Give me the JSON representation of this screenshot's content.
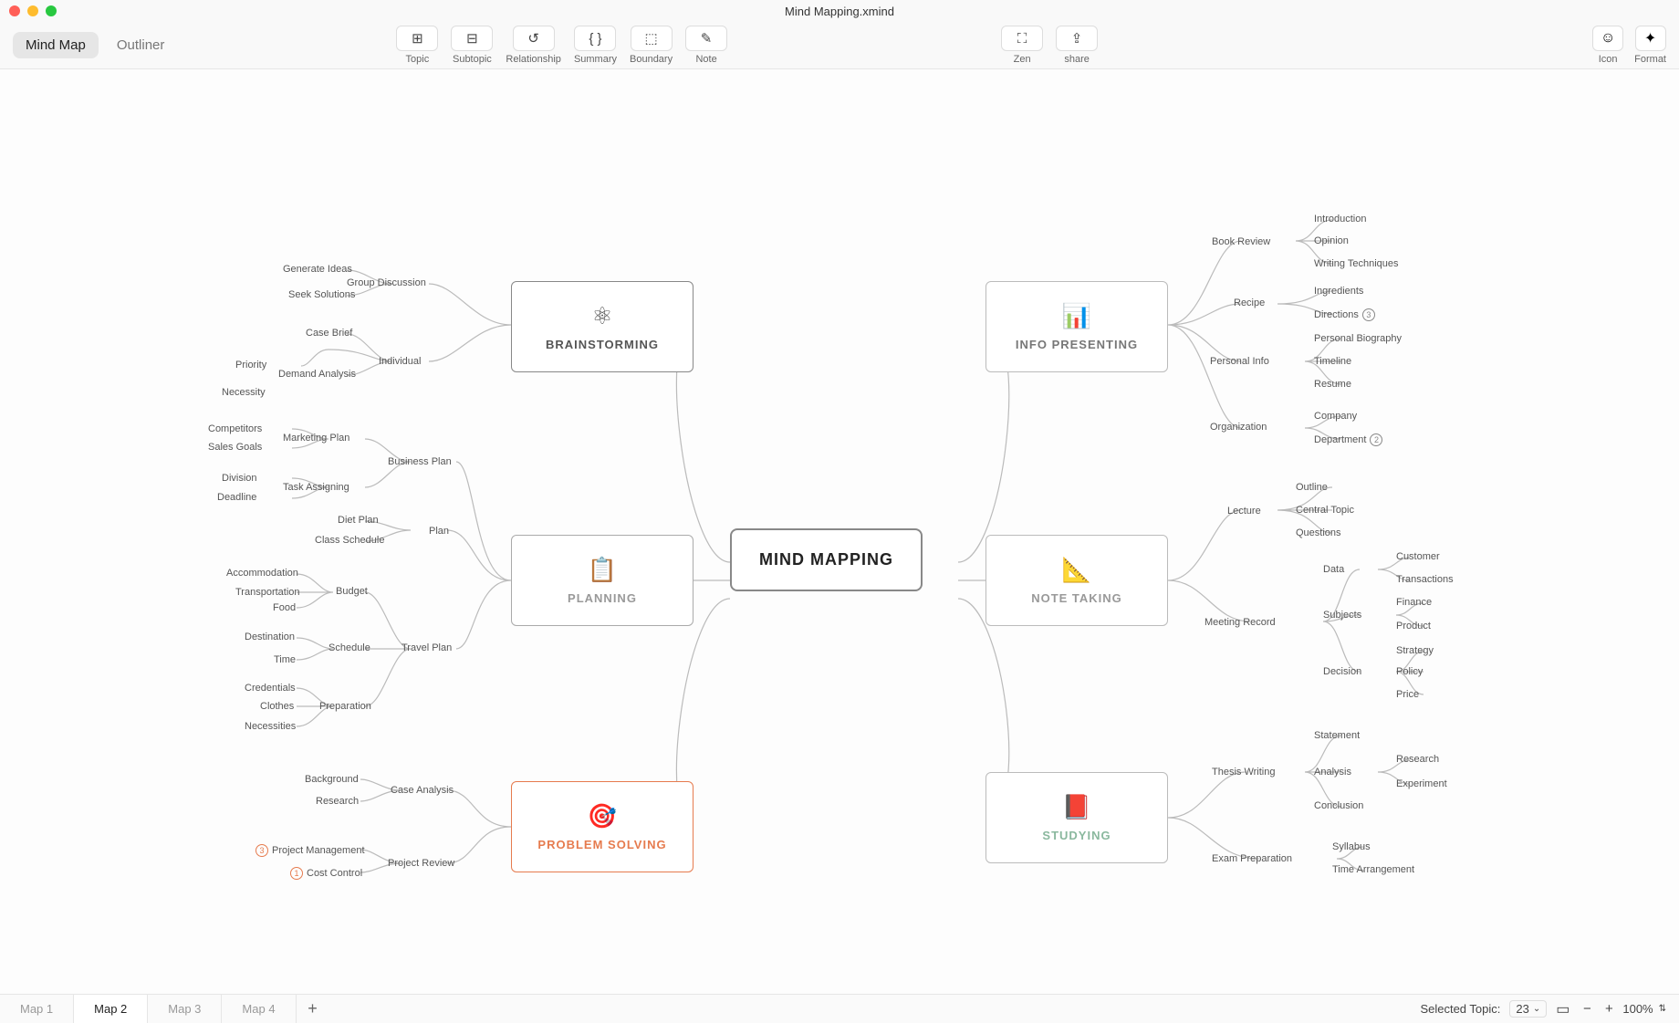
{
  "window_title": "Mind Mapping.xmind",
  "view_tabs": {
    "mindmap": "Mind Map",
    "outliner": "Outliner"
  },
  "tools": {
    "topic": "Topic",
    "subtopic": "Subtopic",
    "relationship": "Relationship",
    "summary": "Summary",
    "boundary": "Boundary",
    "note": "Note",
    "zen": "Zen",
    "share": "share",
    "icon": "Icon",
    "format": "Format"
  },
  "central": "MIND MAPPING",
  "branches": {
    "brainstorming": {
      "label": "BRAINSTORMING",
      "children": [
        {
          "label": "Group Discussion",
          "children": [
            "Generate Ideas",
            "Seek Solutions"
          ]
        },
        {
          "label": "Individual",
          "children": [
            "Case Brief",
            "Priority",
            "Demand Analysis",
            "Necessity"
          ]
        }
      ]
    },
    "planning": {
      "label": "PLANNING",
      "children": [
        {
          "label": "Business Plan",
          "children": [
            {
              "label": "Marketing Plan",
              "children": [
                "Competitors",
                "Sales Goals"
              ]
            },
            {
              "label": "Task Assigning",
              "children": [
                "Division",
                "Deadline"
              ]
            }
          ]
        },
        {
          "label": "Plan",
          "children": [
            "Diet Plan",
            "Class Schedule"
          ]
        },
        {
          "label": "Travel Plan",
          "children": [
            {
              "label": "Budget",
              "children": [
                "Accommodation",
                "Transportation",
                "Food"
              ]
            },
            {
              "label": "Schedule",
              "children": [
                "Destination",
                "Time"
              ]
            },
            {
              "label": "Preparation",
              "children": [
                "Credentials",
                "Clothes",
                "Necessities"
              ]
            }
          ]
        }
      ]
    },
    "problem": {
      "label": "PROBLEM SOLVING",
      "children": [
        {
          "label": "Case Analysis",
          "children": [
            "Background",
            "Research"
          ]
        },
        {
          "label": "Project Review",
          "children": [
            "Project Management",
            "Cost Control"
          ],
          "badges": [
            "3",
            "1"
          ]
        }
      ]
    },
    "info": {
      "label": "INFO PRESENTING",
      "children": [
        {
          "label": "Book Review",
          "children": [
            "Introduction",
            "Opinion",
            "Writing Techniques"
          ]
        },
        {
          "label": "Recipe",
          "children": [
            "Ingredients",
            "Directions"
          ],
          "trailing_badge": "3"
        },
        {
          "label": "Personal Info",
          "children": [
            "Personal Biography",
            "Timeline",
            "Resume"
          ]
        },
        {
          "label": "Organization",
          "children": [
            "Company",
            "Department"
          ],
          "trailing_badge": "2"
        }
      ]
    },
    "notetaking": {
      "label": "NOTE TAKING",
      "children": [
        {
          "label": "Lecture",
          "children": [
            "Outline",
            "Central Topic",
            "Questions"
          ]
        },
        {
          "label": "Meeting Record",
          "children": [
            {
              "label": "Data",
              "children": [
                "Customer",
                "Transactions"
              ]
            },
            {
              "label": "Subjects",
              "children": [
                "Finance",
                "Product"
              ]
            },
            {
              "label": "Decision",
              "children": [
                "Strategy",
                "Policy",
                "Price"
              ]
            }
          ]
        }
      ]
    },
    "studying": {
      "label": "STUDYING",
      "children": [
        {
          "label": "Thesis Writing",
          "children": [
            "Statement",
            "Analysis",
            "Conclusion",
            "Research",
            "Experiment"
          ]
        },
        {
          "label": "Exam Preparation",
          "children": [
            "Syllabus",
            "Time Arrangement"
          ]
        }
      ]
    }
  },
  "sheets": [
    "Map 1",
    "Map 2",
    "Map 3",
    "Map 4"
  ],
  "active_sheet": 1,
  "status": {
    "selected_label": "Selected Topic:",
    "selected_count": "23",
    "zoom": "100%"
  }
}
